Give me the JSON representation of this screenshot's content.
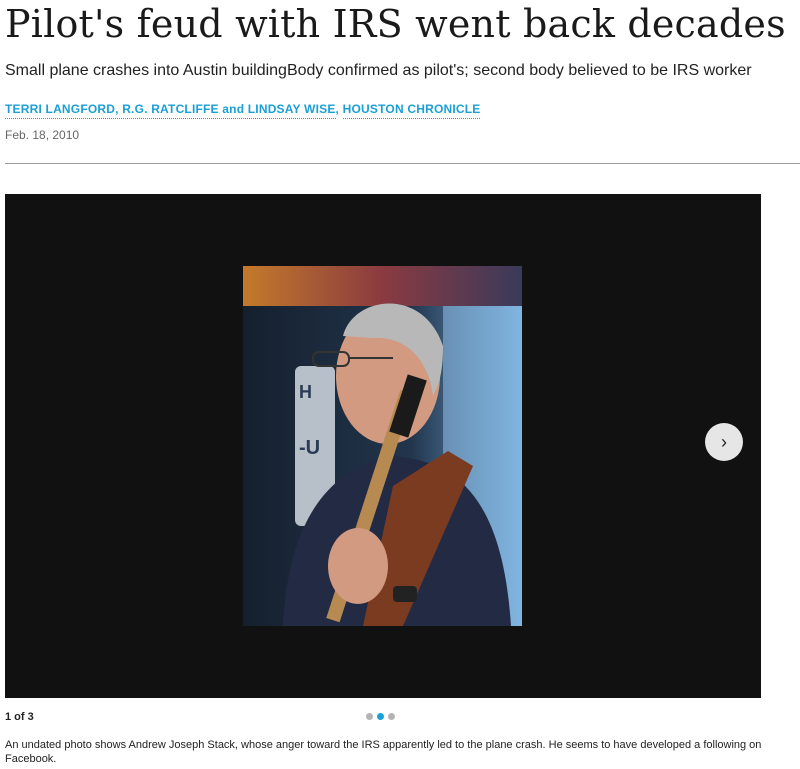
{
  "article": {
    "headline": "Pilot's feud with IRS went back decades",
    "subhead": "Small plane crashes into Austin buildingBody confirmed as pilot's; second body believed to be IRS worker",
    "byline": {
      "authors": "TERRI LANGFORD, R.G. RATCLIFFE and LINDSAY WISE",
      "separator": ",",
      "outlet": "HOUSTON CHRONICLE"
    },
    "date": "Feb. 18, 2010"
  },
  "gallery": {
    "counter": "1 of 3",
    "total": 3,
    "active_index": 1,
    "next_icon": "›",
    "caption": "An undated photo shows Andrew Joseph Stack, whose anger toward the IRS apparently led to the plane crash. He seems to have developed a following on Facebook."
  },
  "colors": {
    "link": "#1b9fd6",
    "gallery_bg": "#111111",
    "dot_inactive": "#b3b3b3"
  }
}
